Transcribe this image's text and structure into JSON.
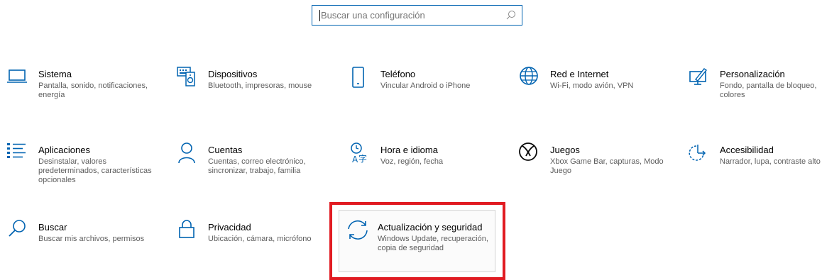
{
  "search": {
    "placeholder": "Buscar una configuración",
    "icon": "search-icon"
  },
  "accent_color": "#0063b1",
  "highlight_color": "#e11b22",
  "tiles": [
    {
      "icon": "laptop-icon",
      "title": "Sistema",
      "desc": "Pantalla, sonido, notificaciones, energía"
    },
    {
      "icon": "devices-icon",
      "title": "Dispositivos",
      "desc": "Bluetooth, impresoras, mouse"
    },
    {
      "icon": "phone-icon",
      "title": "Teléfono",
      "desc": "Vincular Android o iPhone"
    },
    {
      "icon": "globe-icon",
      "title": "Red e Internet",
      "desc": "Wi-Fi, modo avión, VPN"
    },
    {
      "icon": "personalization-icon",
      "title": "Personalización",
      "desc": "Fondo, pantalla de bloqueo, colores"
    },
    {
      "icon": "apps-icon",
      "title": "Aplicaciones",
      "desc": "Desinstalar, valores predeterminados, características opcionales"
    },
    {
      "icon": "person-icon",
      "title": "Cuentas",
      "desc": "Cuentas, correo electrónico, sincronizar, trabajo, familia"
    },
    {
      "icon": "language-icon",
      "title": "Hora e idioma",
      "desc": "Voz, región, fecha"
    },
    {
      "icon": "xbox-icon",
      "title": "Juegos",
      "desc": "Xbox Game Bar, capturas, Modo Juego"
    },
    {
      "icon": "accessibility-icon",
      "title": "Accesibilidad",
      "desc": "Narrador, lupa, contraste alto"
    },
    {
      "icon": "search-icon",
      "title": "Buscar",
      "desc": "Buscar mis archivos, permisos"
    },
    {
      "icon": "lock-icon",
      "title": "Privacidad",
      "desc": "Ubicación, cámara, micrófono"
    },
    {
      "icon": "sync-icon",
      "title": "Actualización y seguridad",
      "desc": "Windows Update, recuperación, copia de seguridad"
    }
  ]
}
